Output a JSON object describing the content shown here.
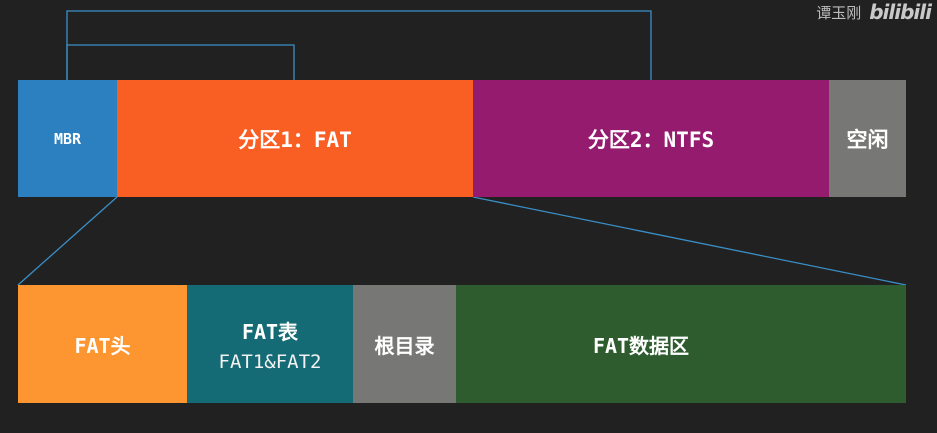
{
  "top_bar": {
    "mbr": "MBR",
    "partition1": "分区1：FAT",
    "partition2": "分区2：NTFS",
    "free": "空闲"
  },
  "bottom_bar": {
    "fat_header": "FAT头",
    "fat_table": "FAT表",
    "fat_table_sub": "FAT1&FAT2",
    "root_dir": "根目录",
    "fat_data": "FAT数据区"
  },
  "watermark": {
    "author": "谭玉刚",
    "logo": "bilibili"
  },
  "colors": {
    "background": "#212121",
    "line": "#3a8fc7",
    "mbr": "#2c80c0",
    "partition1": "#f95e23",
    "partition2": "#951b6e",
    "free": "#777876",
    "fat_header": "#fd9530",
    "fat_table": "#156b75",
    "root_dir": "#777876",
    "fat_data": "#2e5c2e"
  }
}
